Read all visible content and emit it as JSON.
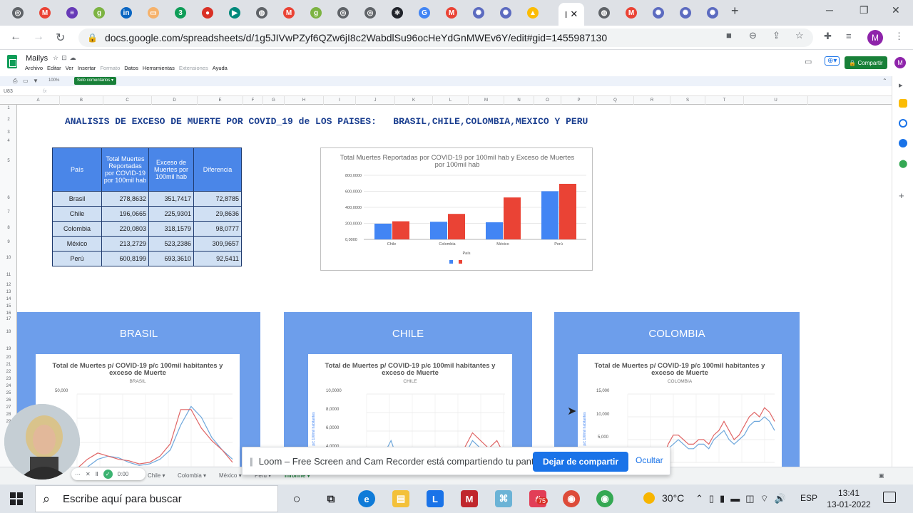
{
  "browser": {
    "url": "docs.google.com/spreadsheets/d/1g5JIVwPZyf6QZw6jI8c2WabdlSu96ocHeYdGnMWEv6Y/edit#gid=1455987130",
    "active_tab_label": "I",
    "profile_initial": "M",
    "tab_icons": [
      "chrome-icon",
      "gmail-icon",
      "forms-icon",
      "vid-icon",
      "linkedin-icon",
      "pic-icon",
      "three-icon",
      "record-icon",
      "meet-icon",
      "globe-icon",
      "gmail-icon",
      "vid-icon",
      "chrome-icon",
      "chrome-icon",
      "react-icon",
      "translate-icon",
      "gmail-icon",
      "flower-icon",
      "flower-icon",
      "drive-icon"
    ]
  },
  "sheets": {
    "doc_title": "Mailys",
    "menu": [
      "Archivo",
      "Editar",
      "Ver",
      "Insertar",
      "Formato",
      "Datos",
      "Herramientas",
      "Extensiones",
      "Ayuda"
    ],
    "share_label": "Compartir",
    "avatar_initial": "M",
    "zoom": "100%",
    "view_only_label": "Solo comentarios",
    "cell_ref": "U83",
    "fx": "fx",
    "columns": [
      "A",
      "B",
      "C",
      "D",
      "E",
      "F",
      "G",
      "H",
      "I",
      "J",
      "K",
      "L",
      "M",
      "N",
      "O",
      "P",
      "Q",
      "R",
      "S",
      "T",
      "U"
    ],
    "rows": [
      "1",
      "2",
      "3",
      "4",
      "5",
      "6",
      "7",
      "8",
      "9",
      "10",
      "11",
      "12",
      "13",
      "14",
      "15",
      "16",
      "17",
      "18",
      "19",
      "20",
      "21",
      "22",
      "23",
      "24",
      "25",
      "26",
      "27",
      "28",
      "29"
    ],
    "sheet_tabs": [
      "Chile",
      "Colombia",
      "México",
      "Peru",
      "Informe"
    ]
  },
  "report": {
    "title": "ANALISIS DE EXCESO DE MUERTE POR COVID_19 de LOS PAISES:   BRASIL,CHILE,COLOMBIA,MEXICO Y PERU",
    "table": {
      "headers": [
        "País",
        "Total Muertes Reportadas por COVID-19 por 100mil hab",
        "Exceso de Muertes por 100mil hab",
        "Diferencia"
      ],
      "rows": [
        [
          "Brasil",
          "278,8632",
          "351,7417",
          "72,8785"
        ],
        [
          "Chile",
          "196,0665",
          "225,9301",
          "29,8636"
        ],
        [
          "Colombia",
          "220,0803",
          "318,1579",
          "98,0777"
        ],
        [
          "México",
          "213,2729",
          "523,2386",
          "309,9657"
        ],
        [
          "Perú",
          "600,8199",
          "693,3610",
          "92,5411"
        ]
      ]
    },
    "panels": [
      {
        "title": "BRASIL",
        "chart_title": "Total de Muertes p/ COVID-19  p/c 100mil habitantes y exceso de Muerte",
        "chart_sub": "BRASIL",
        "ytop": "50,000",
        "ylabel": ""
      },
      {
        "title": "CHILE",
        "chart_title": "Total de Muertes p/ COVID-19  p/c 100mil habitantes y exceso de Muerte",
        "chart_sub": "CHILE",
        "ytop": "10,0000",
        "y2": "8,0000",
        "y3": "6,0000",
        "y4": "4,0000",
        "ylabel": "p/c 100mil habitantes"
      },
      {
        "title": "COLOMBIA",
        "chart_title": "Total de Muertes p/ COVID-19  p/c 100mil habitantes y exceso de Muerte",
        "chart_sub": "COLOMBIA",
        "ytop": "15,000",
        "y2": "10,000",
        "y3": "5,000",
        "ylabel": "p/c 100mil habitantes"
      }
    ]
  },
  "chart_data": {
    "type": "bar",
    "title": "Total Muertes Reportadas  por COVID-19 por 100mil hab y Exceso de Muertes por 100mil hab",
    "xlabel": "País",
    "ylabel": "",
    "categories": [
      "Chile",
      "Colombia",
      "México",
      "Perú"
    ],
    "yticks": [
      "0,0000",
      "200,0000",
      "400,0000",
      "600,0000",
      "800,0000"
    ],
    "ylim": [
      0,
      800
    ],
    "series": [
      {
        "values": [
          196.0665,
          220.0803,
          213.2729,
          600.8199
        ],
        "color": "#4285f4"
      },
      {
        "values": [
          225.9301,
          318.1579,
          523.2386,
          693.361
        ],
        "color": "#ea4335"
      }
    ],
    "legend": "bottom"
  },
  "loom": {
    "message": "Loom – Free Screen and Cam Recorder está compartiendo tu pantalla.",
    "stop_label": "Dejar de compartir",
    "hide_label": "Ocultar",
    "timer": "0:00"
  },
  "taskbar": {
    "search_placeholder": "Escribe aquí para buscar",
    "temperature": "30°C",
    "language": "ESP",
    "time": "13:41",
    "date": "13-01-2022",
    "badge": "75"
  }
}
